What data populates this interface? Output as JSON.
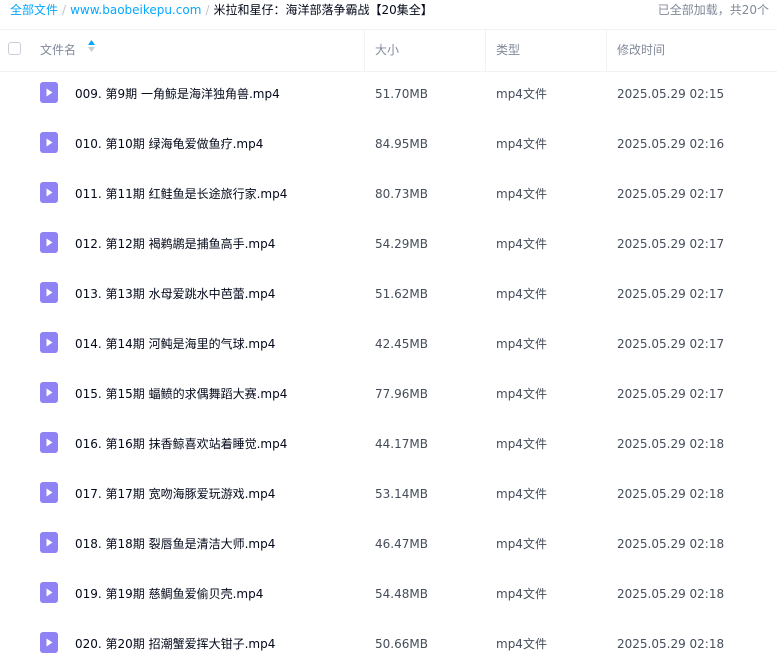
{
  "breadcrumb": {
    "root": "全部文件",
    "site": "www.baobeikepu.com",
    "folder": "米拉和星仔：海洋部落争霸战【20集全】",
    "separator": "/"
  },
  "load_status": "已全部加载，共20个",
  "columns": {
    "name": "文件名",
    "size": "大小",
    "type": "类型",
    "modified": "修改时间"
  },
  "icons": {
    "file": "video-file-icon",
    "sort": "sort-arrows-icon",
    "file_color": "#8f82f5",
    "accent": "#06a7ff"
  },
  "files": [
    {
      "name": "009. 第9期 一角鲸是海洋独角兽.mp4",
      "size": "51.70MB",
      "type": "mp4文件",
      "modified": "2025.05.29 02:15"
    },
    {
      "name": "010. 第10期 绿海龟爱做鱼疗.mp4",
      "size": "84.95MB",
      "type": "mp4文件",
      "modified": "2025.05.29 02:16"
    },
    {
      "name": "011. 第11期 红鲑鱼是长途旅行家.mp4",
      "size": "80.73MB",
      "type": "mp4文件",
      "modified": "2025.05.29 02:17"
    },
    {
      "name": "012. 第12期 褐鹈鹕是捕鱼高手.mp4",
      "size": "54.29MB",
      "type": "mp4文件",
      "modified": "2025.05.29 02:17"
    },
    {
      "name": "013. 第13期 水母爱跳水中芭蕾.mp4",
      "size": "51.62MB",
      "type": "mp4文件",
      "modified": "2025.05.29 02:17"
    },
    {
      "name": "014. 第14期 河鲀是海里的气球.mp4",
      "size": "42.45MB",
      "type": "mp4文件",
      "modified": "2025.05.29 02:17"
    },
    {
      "name": "015. 第15期 蝠鲼的求偶舞蹈大赛.mp4",
      "size": "77.96MB",
      "type": "mp4文件",
      "modified": "2025.05.29 02:17"
    },
    {
      "name": "016. 第16期 抹香鲸喜欢站着睡觉.mp4",
      "size": "44.17MB",
      "type": "mp4文件",
      "modified": "2025.05.29 02:18"
    },
    {
      "name": "017. 第17期 宽吻海豚爱玩游戏.mp4",
      "size": "53.14MB",
      "type": "mp4文件",
      "modified": "2025.05.29 02:18"
    },
    {
      "name": "018. 第18期 裂唇鱼是清洁大师.mp4",
      "size": "46.47MB",
      "type": "mp4文件",
      "modified": "2025.05.29 02:18"
    },
    {
      "name": "019. 第19期 慈鲷鱼爱偷贝壳.mp4",
      "size": "54.48MB",
      "type": "mp4文件",
      "modified": "2025.05.29 02:18"
    },
    {
      "name": "020. 第20期 招潮蟹爱挥大钳子.mp4",
      "size": "50.66MB",
      "type": "mp4文件",
      "modified": "2025.05.29 02:18"
    }
  ]
}
